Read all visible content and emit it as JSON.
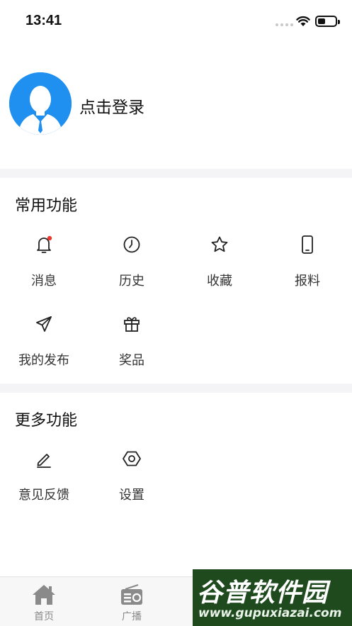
{
  "status_bar": {
    "time": "13:41",
    "battery_level": 0.45
  },
  "profile": {
    "login_label": "点击登录"
  },
  "sections": [
    {
      "title": "常用功能",
      "items": [
        {
          "label": "消息",
          "icon": "bell-icon",
          "has_badge": true
        },
        {
          "label": "历史",
          "icon": "clock-icon"
        },
        {
          "label": "收藏",
          "icon": "star-icon"
        },
        {
          "label": "报料",
          "icon": "phone-icon"
        },
        {
          "label": "我的发布",
          "icon": "send-icon"
        },
        {
          "label": "奖品",
          "icon": "gift-icon"
        }
      ]
    },
    {
      "title": "更多功能",
      "items": [
        {
          "label": "意见反馈",
          "icon": "pencil-icon"
        },
        {
          "label": "设置",
          "icon": "settings-icon"
        }
      ]
    }
  ],
  "tab_bar": {
    "tabs": [
      {
        "label": "首页",
        "icon": "home-icon"
      },
      {
        "label": "广播",
        "icon": "radio-icon"
      }
    ]
  },
  "watermark": {
    "brand": "谷普软件园",
    "url": "www.gupuxiazai.com"
  },
  "colors": {
    "avatar_bg": "#1f8ff0",
    "badge": "#e8382f",
    "divider": "#f4f4f6"
  }
}
